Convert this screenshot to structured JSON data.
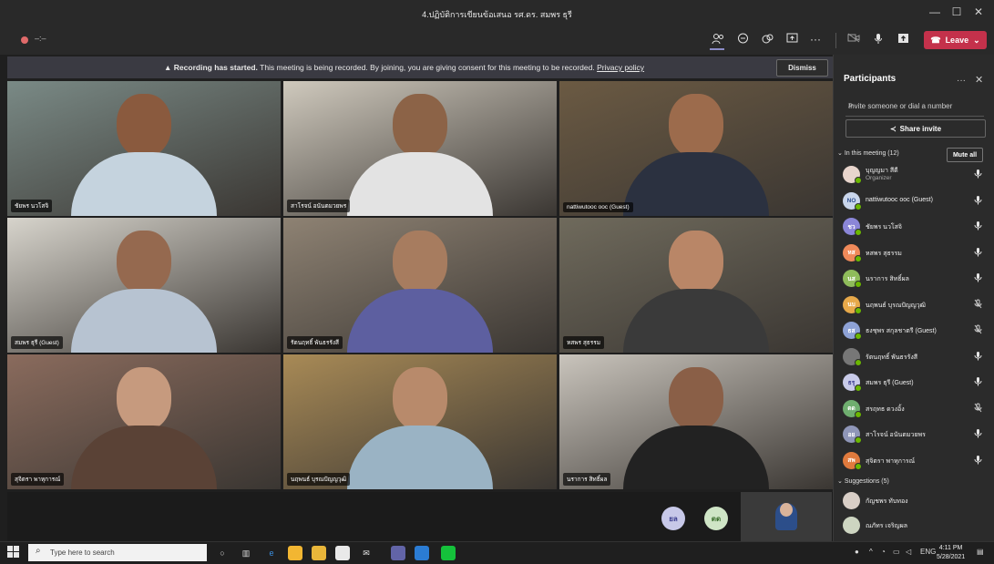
{
  "window": {
    "title": "4.ปฏิบัติการเขียนข้อเสนอ รศ.ดร. สมพร ธุรี",
    "minimize": "—",
    "maximize": "☐",
    "close": "✕"
  },
  "toolbar": {
    "timer": "–:–",
    "leave_label": "Leave"
  },
  "banner": {
    "title": "Recording has started.",
    "message": "This meeting is being recorded. By joining, you are giving consent for this meeting to be recorded.",
    "link": "Privacy policy",
    "dismiss": "Dismiss"
  },
  "tiles": [
    {
      "name": "ชัยพร นวโสจิ",
      "bg": "#7a8a86",
      "skin": "#8a5a3e",
      "shirt": "#c5d3de"
    },
    {
      "name": "สาโรจน์ อนันตมวยพร",
      "bg": "#cfc9bd",
      "skin": "#8c6347",
      "shirt": "#e3e3e3"
    },
    {
      "name": "nattiwutooc ooc (Guest)",
      "bg": "#6b5a43",
      "skin": "#9c6b4c",
      "shirt": "#2b3140"
    },
    {
      "name": "สมพร ธุรี (Guest)",
      "bg": "#d7d4cc",
      "skin": "#95694f",
      "shirt": "#b7c3d1"
    },
    {
      "name": "รัตนฤทธิ์ พันธรรังสี",
      "bg": "#8e8273",
      "skin": "#a77c5f",
      "shirt": "#5d5fa0"
    },
    {
      "name": "หสพร สุธรรม",
      "bg": "#6f6a5c",
      "skin": "#b98667",
      "shirt": "#3a3a3a"
    },
    {
      "name": "สุจิตรา พาหุการณ์",
      "bg": "#8a6b5d",
      "skin": "#c69a7e",
      "shirt": "#5a4236"
    },
    {
      "name": "นฤพนธ์ บุรณปัญญวุฒิ",
      "bg": "#a88a56",
      "skin": "#b88a6b",
      "shirt": "#9ab3c4"
    },
    {
      "name": "นราการ สิทธิ์ผล",
      "bg": "#c9c4bc",
      "skin": "#8a5f47",
      "shirt": "#222222"
    }
  ],
  "strip": {
    "avatars": [
      {
        "initials": "ยล",
        "bg": "#c7c8e8",
        "fg": "#3d3f8f"
      },
      {
        "initials": "ตด",
        "bg": "#cfe5c6",
        "fg": "#3b6e2d"
      }
    ]
  },
  "panel": {
    "title": "Participants",
    "more": "···",
    "close": "✕",
    "invite_placeholder": "Invite someone or dial a number",
    "share_invite": "Share invite",
    "in_meeting": "In this meeting (12)",
    "mute_all": "Mute all",
    "suggestions": "Suggestions (5)",
    "participants": [
      {
        "initials": "",
        "name": "บุญญมา สีดี",
        "role": "Organizer",
        "bg": "#e8d5cc",
        "muted": false
      },
      {
        "initials": "NO",
        "name": "nattiwutooc ooc (Guest)",
        "role": "",
        "bg": "#c9d6ec",
        "fg": "#2f4f8f",
        "muted": false
      },
      {
        "initials": "ชว",
        "name": "ชัยพร นวโสจิ",
        "role": "",
        "bg": "#8b86d8",
        "muted": false
      },
      {
        "initials": "หส",
        "name": "หสพร สุธรรม",
        "role": "",
        "bg": "#f08a5a",
        "muted": false
      },
      {
        "initials": "นส",
        "name": "นราการ สิทธิ์ผล",
        "role": "",
        "bg": "#8fbc5b",
        "muted": false
      },
      {
        "initials": "นบ",
        "name": "นฤพนธ์ บุรณปัญญวุฒิ",
        "role": "",
        "bg": "#e7a94a",
        "muted": true
      },
      {
        "initials": "ธส",
        "name": "ธงชุพร สกุลชาตรี (Guest)",
        "role": "",
        "bg": "#8ea2d6",
        "muted": true
      },
      {
        "initials": "",
        "name": "รัตนฤทธิ์ พันธรรังสี",
        "role": "",
        "bg": "#777777",
        "muted": false
      },
      {
        "initials": "ธรุ",
        "name": "สมพร ธุรี (Guest)",
        "role": "",
        "bg": "#c9cbe9",
        "fg": "#3d3f8f",
        "muted": false
      },
      {
        "initials": "ตด",
        "name": "สรฤทธ ดวงอิ้ง",
        "role": "",
        "bg": "#6fae6f",
        "muted": true
      },
      {
        "initials": "อย",
        "name": "สาโรจน์ อนันตมวยพร",
        "role": "",
        "bg": "#8f96b8",
        "muted": false
      },
      {
        "initials": "สพ",
        "name": "สุจิตรา พาหุการณ์",
        "role": "",
        "bg": "#e07a3d",
        "muted": false
      }
    ],
    "suggested": [
      {
        "name": "กัญชพร ทับทอง",
        "bg": "#d9cfc7"
      },
      {
        "name": "ณภัทร เจริญผล",
        "bg": "#cdd5c1"
      }
    ]
  },
  "taskbar": {
    "search_placeholder": "Type here to search",
    "lang": "ENG",
    "time": "4:11 PM",
    "date": "5/28/2021"
  }
}
